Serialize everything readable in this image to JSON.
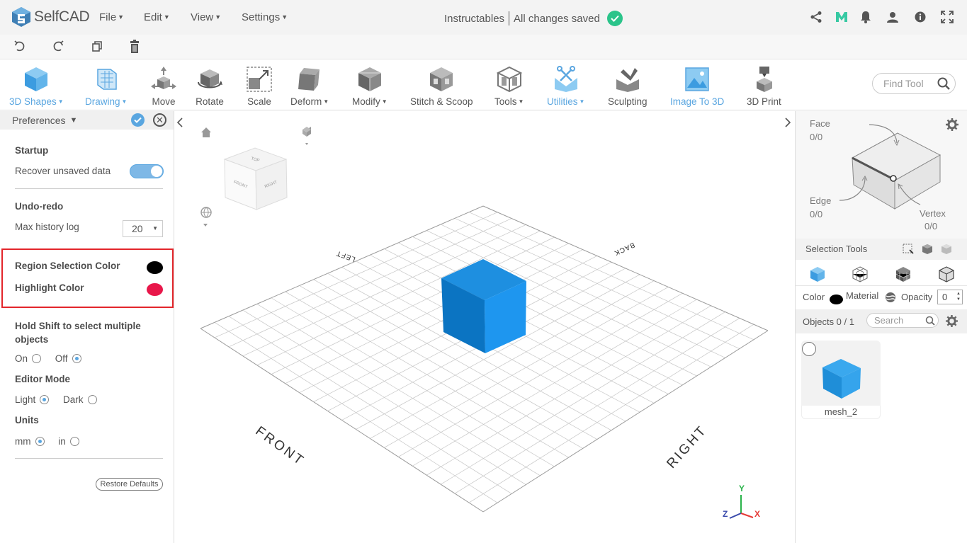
{
  "app": {
    "name": "SelfCAD"
  },
  "menu": [
    {
      "label": "File"
    },
    {
      "label": "Edit"
    },
    {
      "label": "View"
    },
    {
      "label": "Settings"
    }
  ],
  "project": {
    "name": "Instructables",
    "status": "All changes saved"
  },
  "toolbar": {
    "tools": [
      {
        "label": "3D Shapes",
        "dropdown": true,
        "accent": true
      },
      {
        "label": "Drawing",
        "dropdown": true,
        "accent": true
      },
      {
        "label": "Move",
        "dropdown": false,
        "accent": false
      },
      {
        "label": "Rotate",
        "dropdown": false,
        "accent": false
      },
      {
        "label": "Scale",
        "dropdown": false,
        "accent": false
      },
      {
        "label": "Deform",
        "dropdown": true,
        "accent": false
      },
      {
        "label": "Modify",
        "dropdown": true,
        "accent": false
      },
      {
        "label": "Stitch & Scoop",
        "dropdown": false,
        "accent": false
      },
      {
        "label": "Tools",
        "dropdown": true,
        "accent": false
      },
      {
        "label": "Utilities",
        "dropdown": true,
        "accent": true
      },
      {
        "label": "Sculpting",
        "dropdown": false,
        "accent": false
      },
      {
        "label": "Image To 3D",
        "dropdown": false,
        "accent": true
      },
      {
        "label": "3D Print",
        "dropdown": false,
        "accent": false
      }
    ],
    "find_placeholder": "Find Tool"
  },
  "preferences": {
    "title": "Preferences",
    "startup": {
      "heading": "Startup",
      "recover_label": "Recover unsaved data",
      "recover_on": true
    },
    "undo": {
      "heading": "Undo-redo",
      "history_label": "Max history log",
      "history_value": "20"
    },
    "region_color": {
      "label": "Region Selection Color",
      "color": "#000000"
    },
    "highlight_color": {
      "label": "Highlight Color",
      "color": "#e8174a"
    },
    "shift": {
      "heading": "Hold Shift to select multiple objects",
      "on_label": "On",
      "off_label": "Off",
      "selected": "Off"
    },
    "editor": {
      "heading": "Editor Mode",
      "light_label": "Light",
      "dark_label": "Dark",
      "selected": "Light"
    },
    "units": {
      "heading": "Units",
      "mm_label": "mm",
      "in_label": "in",
      "selected": "mm"
    },
    "restore_label": "Restore Defaults"
  },
  "viewport": {
    "labels": {
      "front": "FRONT",
      "right": "RIGHT",
      "left": "LEFT",
      "back": "BACK"
    },
    "cube_faces": {
      "top": "TOP",
      "front": "FRONT",
      "right": "RIGHT"
    },
    "axes": {
      "x": "X",
      "y": "Y",
      "z": "Z"
    },
    "cube_color": "#1e8fe0"
  },
  "selection": {
    "face_label": "Face",
    "face_count": "0/0",
    "edge_label": "Edge",
    "edge_count": "0/0",
    "vertex_label": "Vertex",
    "vertex_count": "0/0",
    "tools_label": "Selection Tools"
  },
  "properties": {
    "color_label": "Color",
    "material_label": "Material",
    "opacity_label": "Opacity",
    "opacity_value": "0"
  },
  "objects": {
    "header": "Objects 0 / 1",
    "search_placeholder": "Search",
    "items": [
      {
        "name": "mesh_2"
      }
    ]
  }
}
